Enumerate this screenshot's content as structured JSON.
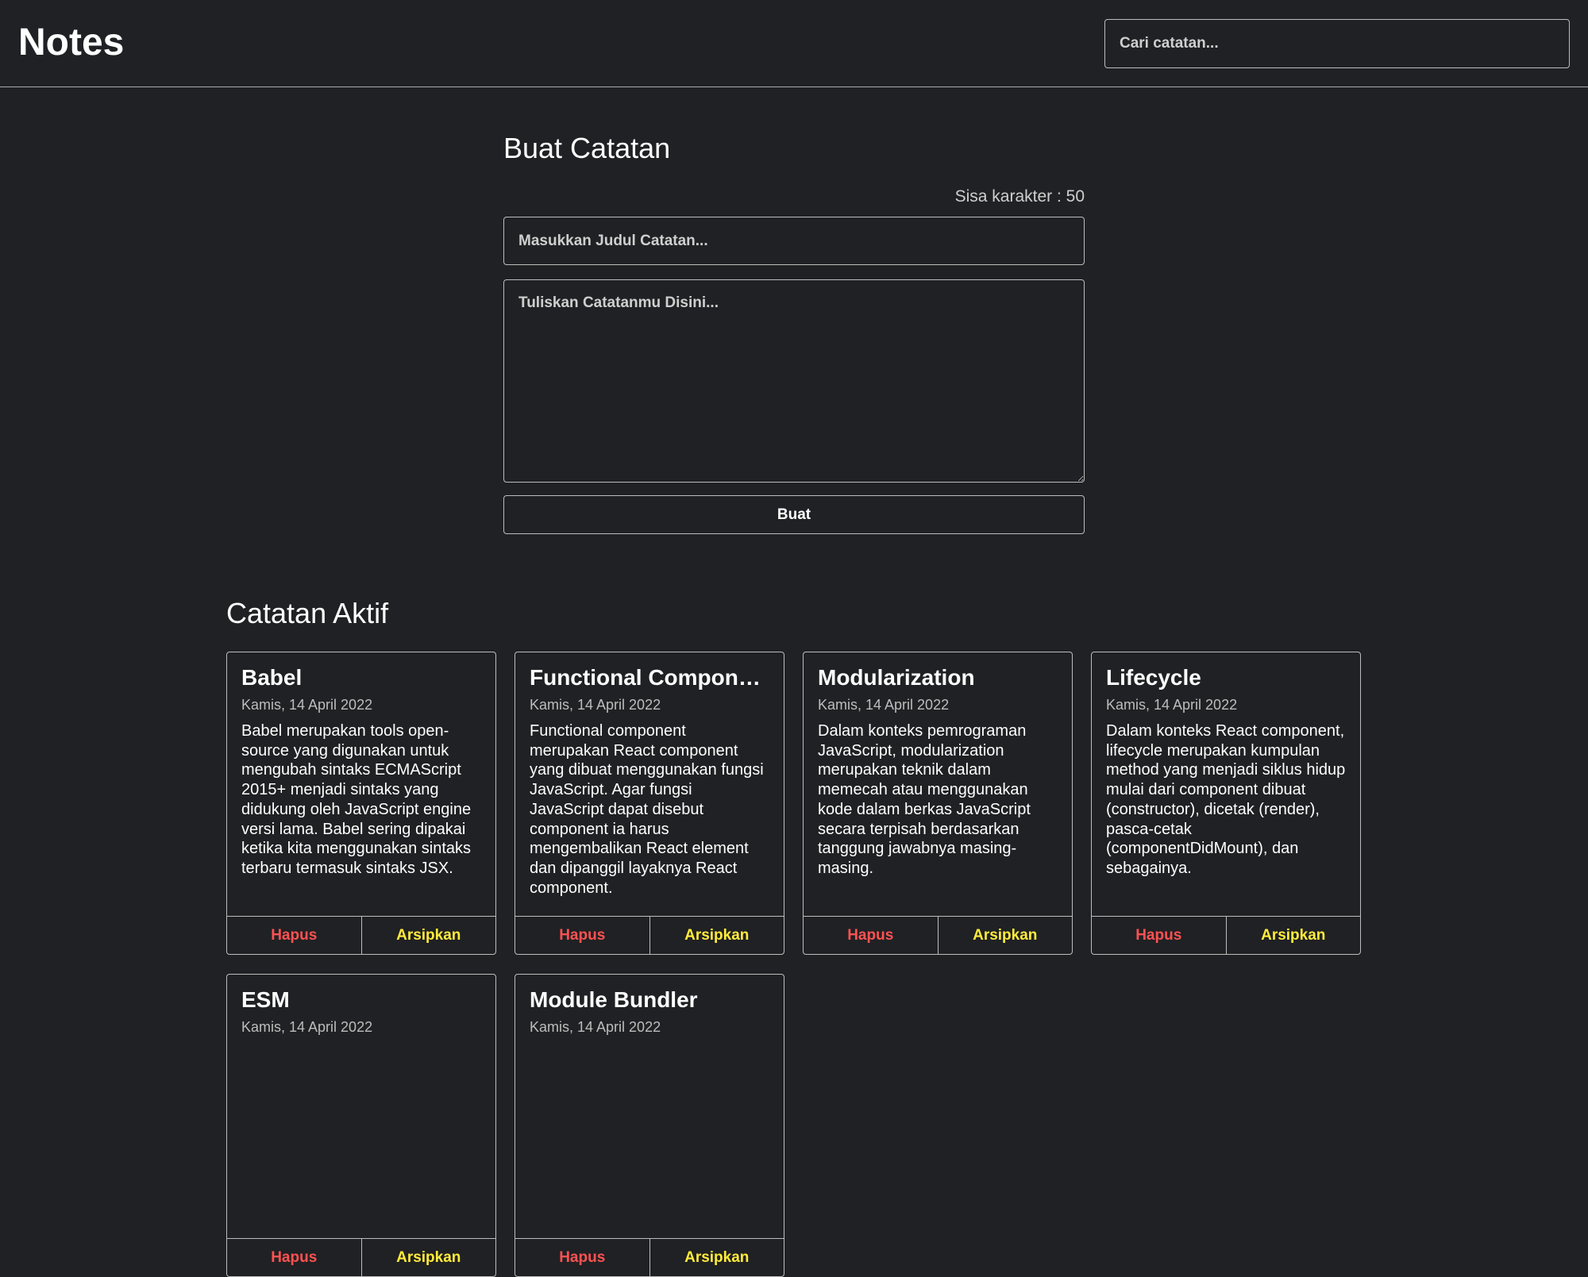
{
  "header": {
    "brand": "Notes",
    "search_placeholder": "Cari catatan..."
  },
  "composer": {
    "heading": "Buat Catatan",
    "char_remaining": "Sisa karakter : 50",
    "title_placeholder": "Masukkan Judul Catatan...",
    "body_placeholder": "Tuliskan Catatanmu Disini...",
    "submit_label": "Buat"
  },
  "active_notes": {
    "heading": "Catatan Aktif",
    "notes": [
      {
        "title": "Babel",
        "date": "Kamis, 14 April 2022",
        "body": "Babel merupakan tools open-source yang digunakan untuk mengubah sintaks ECMAScript 2015+ menjadi sintaks yang didukung oleh JavaScript engine versi lama. Babel sering dipakai ketika kita menggunakan sintaks terbaru termasuk sintaks JSX.",
        "delete_label": "Hapus",
        "archive_label": "Arsipkan"
      },
      {
        "title": "Functional Component",
        "date": "Kamis, 14 April 2022",
        "body": "Functional component merupakan React component yang dibuat menggunakan fungsi JavaScript. Agar fungsi JavaScript dapat disebut component ia harus mengembalikan React element dan dipanggil layaknya React component.",
        "delete_label": "Hapus",
        "archive_label": "Arsipkan"
      },
      {
        "title": "Modularization",
        "date": "Kamis, 14 April 2022",
        "body": "Dalam konteks pemrograman JavaScript, modularization merupakan teknik dalam memecah atau menggunakan kode dalam berkas JavaScript secara terpisah berdasarkan tanggung jawabnya masing-masing.",
        "delete_label": "Hapus",
        "archive_label": "Arsipkan"
      },
      {
        "title": "Lifecycle",
        "date": "Kamis, 14 April 2022",
        "body": "Dalam konteks React component, lifecycle merupakan kumpulan method yang menjadi siklus hidup mulai dari component dibuat (constructor), dicetak (render), pasca-cetak (componentDidMount), dan sebagainya.",
        "delete_label": "Hapus",
        "archive_label": "Arsipkan"
      },
      {
        "title": "ESM",
        "date": "Kamis, 14 April 2022",
        "body": "",
        "delete_label": "Hapus",
        "archive_label": "Arsipkan"
      },
      {
        "title": "Module Bundler",
        "date": "Kamis, 14 April 2022",
        "body": "",
        "delete_label": "Hapus",
        "archive_label": "Arsipkan"
      }
    ]
  },
  "colors": {
    "background": "#202124",
    "border": "#bdbdbd",
    "delete": "#ff5252",
    "archive": "#ffeb3b"
  }
}
